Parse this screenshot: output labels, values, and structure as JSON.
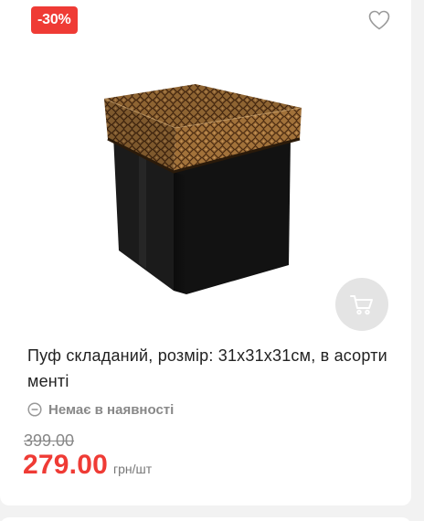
{
  "product": {
    "discount_badge": "-30%",
    "title": "Пуф складаний, розмір: 31x31x31см, в асорти менті",
    "availability": "Немає в наявності",
    "old_price": "399.00",
    "price": "279.00",
    "unit": "грн/шт"
  },
  "icons": {
    "wishlist": "heart-icon",
    "cart": "cart-icon",
    "availability": "minus-circle-icon"
  },
  "colors": {
    "accent": "#ef3b35",
    "muted": "#888888",
    "cart_button_bg": "#e4e4e4"
  }
}
